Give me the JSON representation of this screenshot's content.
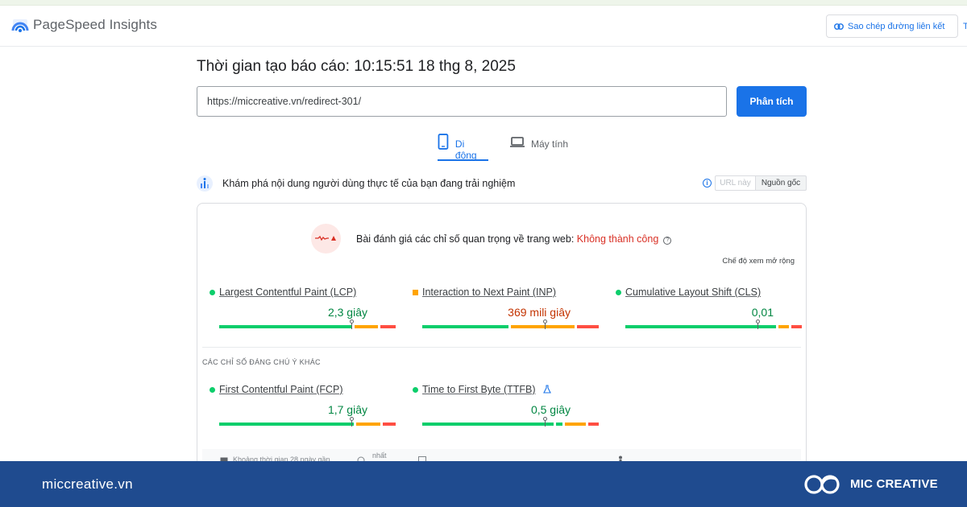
{
  "header": {
    "brand": "PageSpeed Insights",
    "copy_link_label": "Sao chép đường liên kết",
    "cut_button": "T"
  },
  "report": {
    "time_label": "Thời gian tạo báo cáo: 10:15:51 18 thg 8, 2025"
  },
  "search": {
    "url_value": "https://miccreative.vn/redirect-301/",
    "analyze_label": "Phân tích"
  },
  "tabs": {
    "mobile": "Di động",
    "desktop": "Máy tính"
  },
  "crux": {
    "heading": "Khám phá nội dung người dùng thực tế của bạn đang trải nghiệm",
    "info_glyph": "i",
    "toggle_url": "URL này",
    "toggle_origin": "Nguồn gốc"
  },
  "assessment": {
    "text": "Bài đánh giá các chỉ số quan trọng về trang web: ",
    "result": "Không thành công",
    "help_glyph": "?",
    "expand_label": "Chế độ xem mở rộng"
  },
  "metrics": [
    {
      "name": "Largest Contentful Paint (LCP)",
      "value": "2,3 giây",
      "status": "good",
      "marker_fraction": 0.75
    },
    {
      "name": "Interaction to Next Paint (INP)",
      "value": "369 mili giây",
      "status": "needs-improvement",
      "marker_fraction": 0.75
    },
    {
      "name": "Cumulative Layout Shift (CLS)",
      "value": "0,01",
      "status": "good",
      "marker_fraction": 0.75
    }
  ],
  "other_section": {
    "title": "CÁC CHỈ SỐ ĐÁNG CHÚ Ý KHÁC",
    "metrics": [
      {
        "name": "First Contentful Paint (FCP)",
        "value": "1,7 giây",
        "status": "good",
        "marker_fraction": 0.75
      },
      {
        "name": "Time to First Byte (TTFB)",
        "value": "0,5 giây",
        "status": "good",
        "marker_fraction": 0.75,
        "experimental_icon": "flask-icon"
      }
    ]
  },
  "footer_strip": {
    "period": "Khoảng thời gian 28 ngày gần",
    "latest": "nhất"
  },
  "branding": {
    "site": "miccreative.vn",
    "company": "MIC CREATIVE"
  },
  "colors": {
    "good": "#0cce6b",
    "needs_improvement": "#ffa400",
    "poor": "#ff4e42",
    "accent": "#1a73e8",
    "fail_text": "#d93025",
    "brand_bar": "#1f4b8f"
  }
}
